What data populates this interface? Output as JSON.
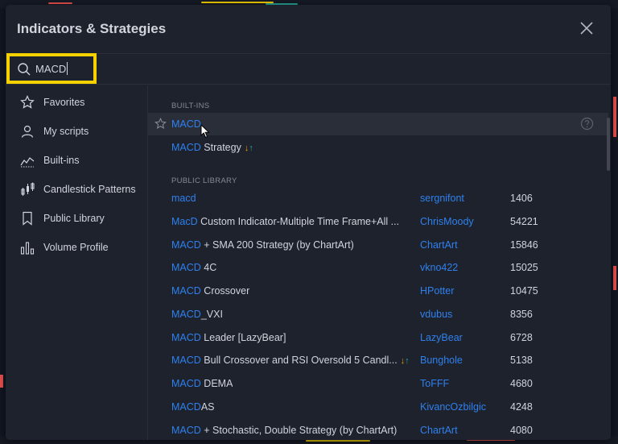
{
  "dialog": {
    "title": "Indicators & Strategies",
    "close_icon": "close-icon"
  },
  "search": {
    "value": "MACD",
    "icon": "search-icon"
  },
  "sidebar": {
    "items": [
      {
        "label": "Favorites",
        "icon": "star-icon"
      },
      {
        "label": "My scripts",
        "icon": "user-icon"
      },
      {
        "label": "Built-ins",
        "icon": "builtins-chart-icon"
      },
      {
        "label": "Candlestick Patterns",
        "icon": "candlestick-icon"
      },
      {
        "label": "Public Library",
        "icon": "bookmark-icon"
      },
      {
        "label": "Volume Profile",
        "icon": "volume-profile-icon"
      }
    ]
  },
  "sections": {
    "builtins_header": "BUILT-INS",
    "public_header": "PUBLIC LIBRARY"
  },
  "builtins": [
    {
      "highlight": "MACD",
      "rest": "",
      "hovered": true
    },
    {
      "highlight": "MACD",
      "rest": " Strategy",
      "strategy_arrows": "↓↑"
    }
  ],
  "public_library": [
    {
      "highlight": "macd",
      "rest": "",
      "author": "sergnifont",
      "likes": "1406"
    },
    {
      "highlight": "MacD",
      "rest": " Custom Indicator-Multiple Time Frame+All ...",
      "author": "ChrisMoody",
      "likes": "54221"
    },
    {
      "highlight": "MACD",
      "rest": " + SMA 200 Strategy (by ChartArt)",
      "author": "ChartArt",
      "likes": "15846"
    },
    {
      "highlight": "MACD",
      "rest": " 4C",
      "author": "vkno422",
      "likes": "15025"
    },
    {
      "highlight": "MACD",
      "rest": " Crossover",
      "author": "HPotter",
      "likes": "10475"
    },
    {
      "highlight": "MACD",
      "rest": "_VXI",
      "author": "vdubus",
      "likes": "8356"
    },
    {
      "highlight": "MACD",
      "rest": " Leader [LazyBear]",
      "author": "LazyBear",
      "likes": "6728"
    },
    {
      "highlight": "MACD",
      "rest": " Bull Crossover and RSI Oversold 5 Candl...",
      "author": "Bunghole",
      "likes": "5138",
      "strategy_arrows": "↓↑"
    },
    {
      "highlight": "MACD",
      "rest": " DEMA",
      "author": "ToFFF",
      "likes": "4680"
    },
    {
      "highlight": "MACD",
      "rest": "AS",
      "author": "KivancOzbilgic",
      "likes": "4248"
    },
    {
      "highlight": "MACD",
      "rest": " + Stochastic, Double Strategy (by ChartArt)",
      "author": "ChartArt",
      "likes": "4080"
    }
  ],
  "colors": {
    "accent": "#2f80ed",
    "highlight_box": "#f5d100",
    "arrow_down": "#ff9800",
    "arrow_up": "#26a69a"
  }
}
